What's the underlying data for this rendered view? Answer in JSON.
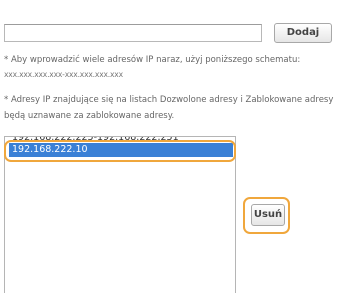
{
  "form": {
    "ip_input_value": "",
    "add_button": "Dodaj",
    "note1": "* Aby wprowadzić wiele adresów IP naraz, użyj poniższego schematu:",
    "note1_format": "xxx.xxx.xxx.xxx-xxx.xxx.xxx.xxx",
    "note2_line1": "* Adresy IP znajdujące się na listach Dozwolone adresy i Zablokowane adresy",
    "note2_line2": "będą uznawane za zablokowane adresy."
  },
  "list": {
    "items": [
      "192.168.222.225-192.168.222.251",
      "192.168.222.10"
    ],
    "selected_index": 1
  },
  "remove_button": "Usuń",
  "colors": {
    "highlight": "#f0a73c",
    "selection": "#3a80d6"
  }
}
